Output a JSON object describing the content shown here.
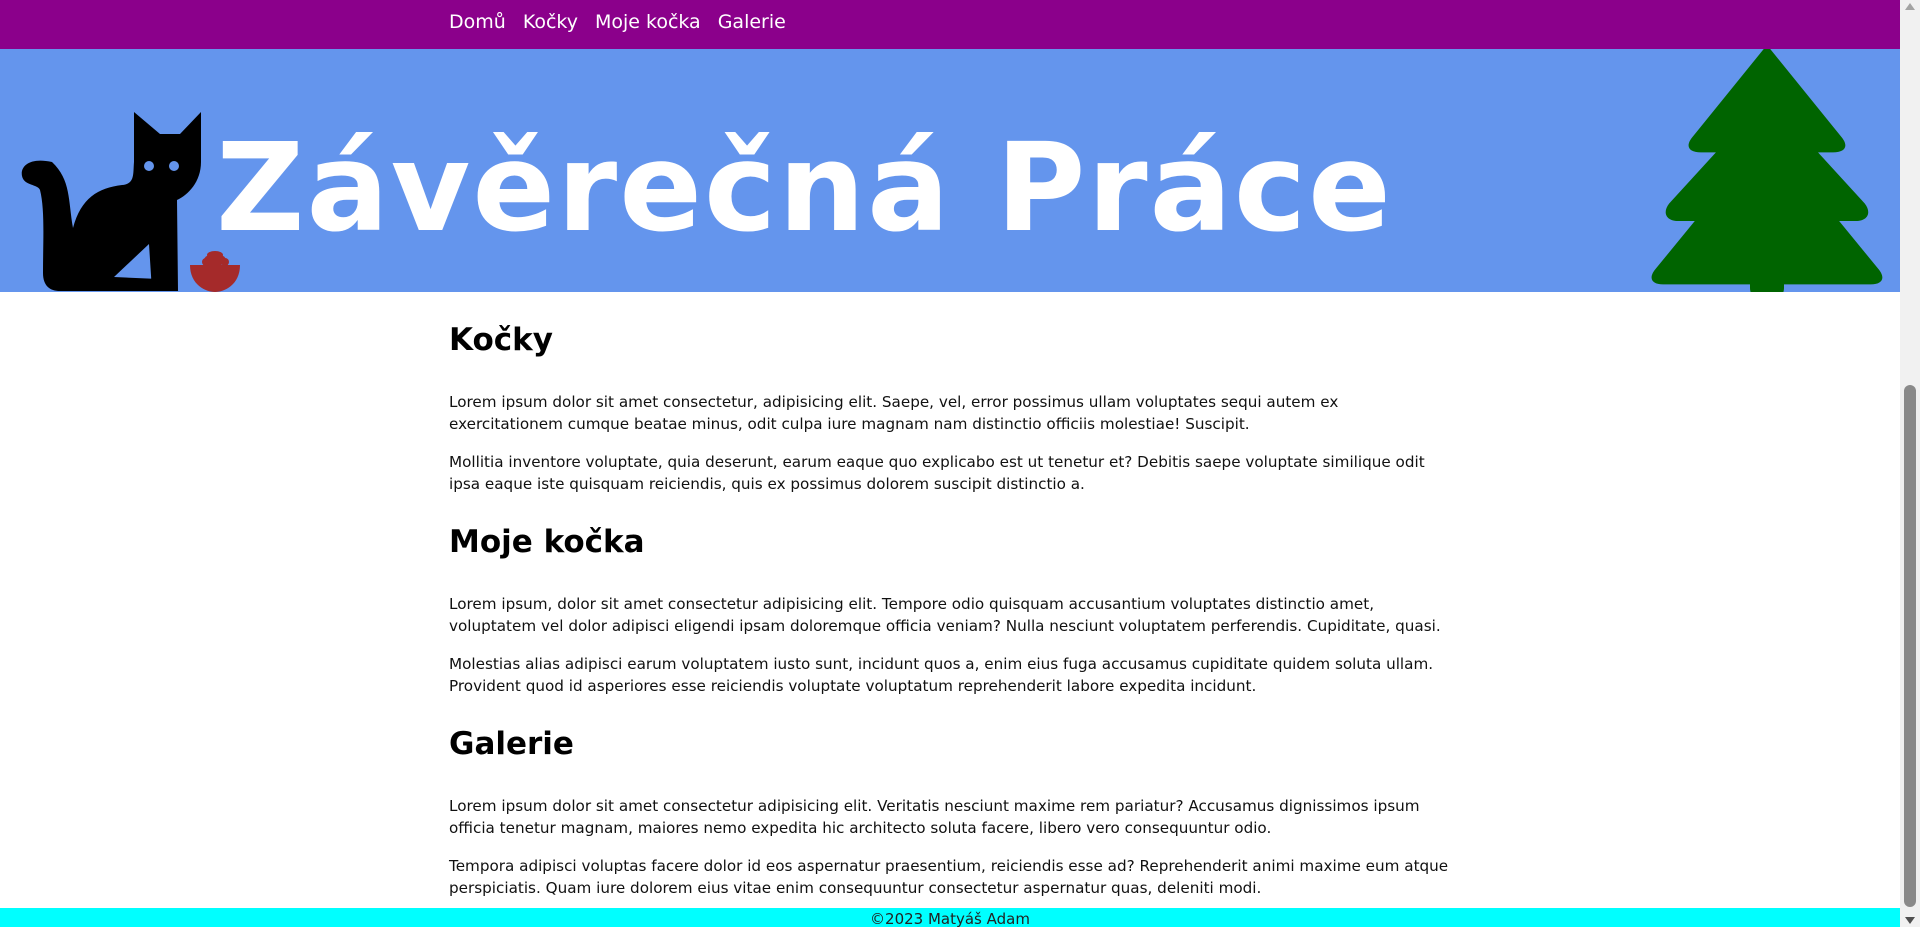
{
  "nav": {
    "items": [
      {
        "label": "Domů"
      },
      {
        "label": "Kočky"
      },
      {
        "label": "Moje kočka"
      },
      {
        "label": "Galerie"
      }
    ]
  },
  "hero": {
    "title": "Závěrečná Práce",
    "left_icon": "cat-with-food-bowl-icon",
    "right_icon": "pine-tree-icon"
  },
  "sections": [
    {
      "heading": "Kočky",
      "paragraphs": [
        "Lorem ipsum dolor sit amet consectetur, adipisicing elit. Saepe, vel, error possimus ullam voluptates sequi autem ex exercitationem cumque beatae minus, odit culpa iure magnam nam distinctio officiis molestiae! Suscipit.",
        "Mollitia inventore voluptate, quia deserunt, earum eaque quo explicabo est ut tenetur et? Debitis saepe voluptate similique odit ipsa eaque iste quisquam reiciendis, quis ex possimus dolorem suscipit distinctio a."
      ]
    },
    {
      "heading": "Moje kočka",
      "paragraphs": [
        "Lorem ipsum, dolor sit amet consectetur adipisicing elit. Tempore odio quisquam accusantium voluptates distinctio amet, voluptatem vel dolor adipisci eligendi ipsam doloremque officia veniam? Nulla nesciunt voluptatem perferendis. Cupiditate, quasi.",
        "Molestias alias adipisci earum voluptatem iusto sunt, incidunt quos a, enim eius fuga accusamus cupiditate quidem soluta ullam. Provident quod id asperiores esse reiciendis voluptate voluptatum reprehenderit labore expedita incidunt."
      ]
    },
    {
      "heading": "Galerie",
      "paragraphs": [
        "Lorem ipsum dolor sit amet consectetur adipisicing elit. Veritatis nesciunt maxime rem pariatur? Accusamus dignissimos ipsum officia tenetur magnam, maiores nemo expedita hic architecto soluta facere, libero vero consequuntur odio.",
        "Tempora adipisci voluptas facere dolor id eos aspernatur praesentium, reiciendis esse ad? Reprehenderit animi maxime eum atque perspiciatis. Quam iure dolorem eius vitae enim consequuntur consectetur aspernatur quas, deleniti modi."
      ]
    }
  ],
  "footer": {
    "text": "©2023 Matyáš Adam"
  },
  "colors": {
    "nav": "#8b008b",
    "hero": "#6495ed",
    "footer": "#00ffff",
    "tree": "#006400",
    "bowl": "#a52a2a"
  }
}
